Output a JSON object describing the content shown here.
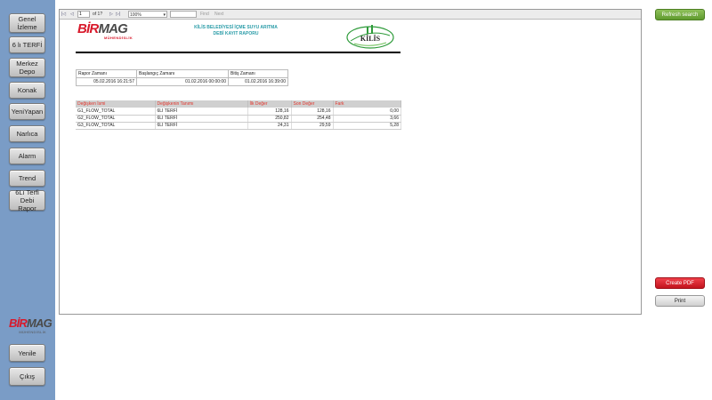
{
  "sidebar": {
    "items": [
      {
        "label": "Genel\nİzleme"
      },
      {
        "label": "6 lı TERFİ"
      },
      {
        "label": "Merkez\nDepo"
      },
      {
        "label": "Konak"
      },
      {
        "label": "YeniYapan"
      },
      {
        "label": "Narlıca"
      },
      {
        "label": "Alarm"
      },
      {
        "label": "Trend"
      },
      {
        "label": "6Lı Terfi\nDebi Rapor"
      }
    ],
    "logo": {
      "brand_red": "BİR",
      "brand_gray": "MAG",
      "sub": "MÜHENDİSLİK"
    },
    "bottom": [
      {
        "label": "Yenile"
      },
      {
        "label": "Çıkış"
      }
    ]
  },
  "toolbar": {
    "page_value": "1",
    "page_of": "of  1?",
    "zoom": "100%",
    "find": "Find",
    "next": "Next"
  },
  "report": {
    "logo": {
      "brand_red": "BİR",
      "brand_gray": "MAG",
      "sub": "MÜHENDİSLİK"
    },
    "title_line1": "KİLİS BELEDİYESİ İÇME SUYU ARITMA",
    "title_line2": "DEBİ KAYIT RAPORU",
    "kilis_logo_text": "KİLİS",
    "info_headers": [
      "Rapor Zamanı",
      "Başlangıç Zamanı",
      "Bitiş Zamanı"
    ],
    "info_values": [
      "05.02.2016 16:21:57",
      "01.02.2016 00:00:00",
      "01.02.2016 16:39:00"
    ],
    "table_headers": [
      "Değişken İsmi",
      "Değişkenin Tanımı",
      "İlk Değer",
      "Son Değer",
      "Fark"
    ],
    "rows": [
      [
        "G1_FLOW_TOTAL",
        "6LI TERFİ",
        "128,16",
        "128,16",
        "0,00"
      ],
      [
        "G2_FLOW_TOTAL",
        "6LI TERFİ",
        "250,82",
        "254,48",
        "3,66"
      ],
      [
        "G3_FLOW_TOTAL",
        "6LI TERFİ",
        "24,31",
        "29,59",
        "5,28"
      ]
    ]
  },
  "actions": {
    "refresh": "Refresh search",
    "create_pdf": "Create PDF",
    "print": "Print"
  },
  "colors": {
    "sidebar": "#7a9cc6",
    "accent_green": "#6aa636",
    "accent_red": "#d8192b",
    "title_teal": "#2a9ca8"
  }
}
